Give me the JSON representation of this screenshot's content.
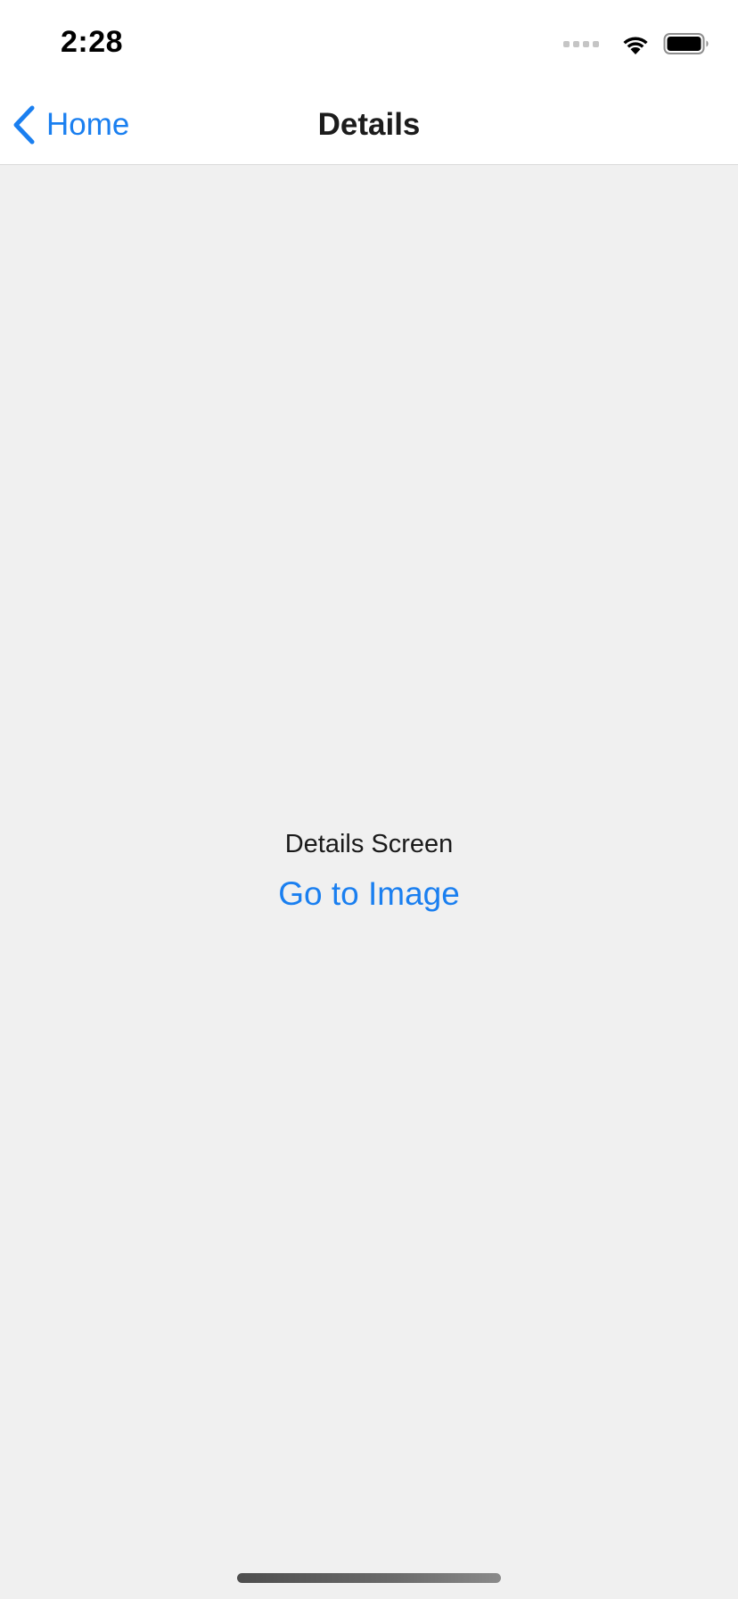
{
  "status_bar": {
    "time": "2:28",
    "icons": [
      "cellular-signal-icon",
      "wifi-icon",
      "battery-icon"
    ]
  },
  "nav_bar": {
    "back_label": "Home",
    "title": "Details"
  },
  "content": {
    "screen_label": "Details Screen",
    "link_label": "Go to Image"
  },
  "colors": {
    "accent": "#1a7ff0",
    "background": "#f0f0f0",
    "header_background": "#ffffff"
  }
}
